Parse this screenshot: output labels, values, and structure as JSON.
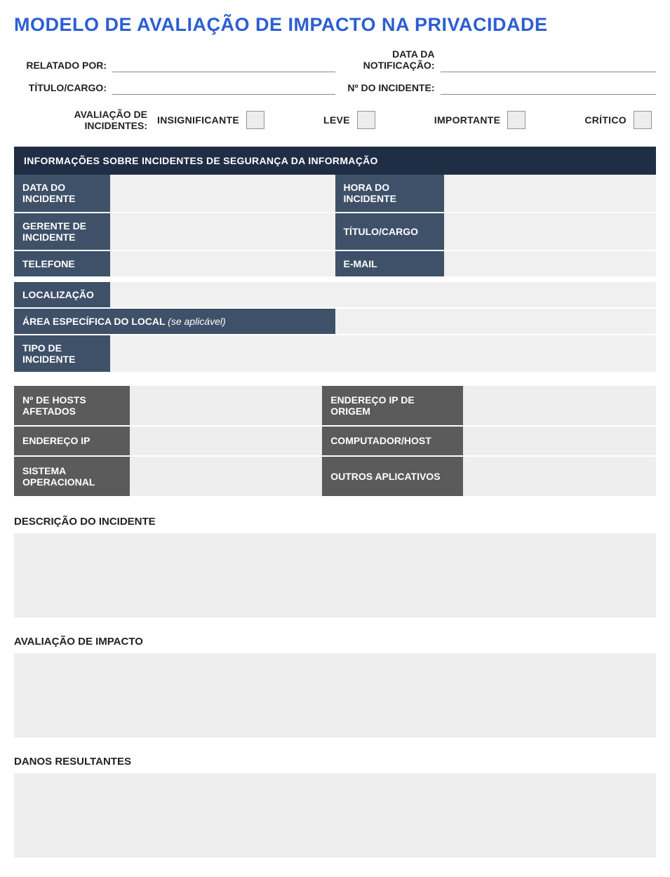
{
  "title": "MODELO DE AVALIAÇÃO DE IMPACTO NA PRIVACIDADE",
  "header": {
    "reported_by_label": "RELATADO POR:",
    "title_role_label": "TÍTULO/CARGO:",
    "notification_date_label": "DATA DA NOTIFICAÇÃO:",
    "incident_no_label": "Nº DO INCIDENTE:",
    "reported_by": "",
    "title_role": "",
    "notification_date": "",
    "incident_no": ""
  },
  "assessment": {
    "lead_label": "AVALIAÇÃO DE INCIDENTES:",
    "options": {
      "insignificant": "INSIGNIFICANTE",
      "light": "LEVE",
      "important": "IMPORTANTE",
      "critical": "CRÍTICO"
    }
  },
  "section_banner": "INFORMAÇÕES SOBRE INCIDENTES DE SEGURANÇA DA INFORMAÇÃO",
  "info": {
    "incident_date_label": "DATA DO INCIDENTE",
    "incident_time_label": "HORA DO INCIDENTE",
    "incident_manager_label": "GERENTE DE INCIDENTE",
    "title_role_label": "TÍTULO/CARGO",
    "phone_label": "TELEFONE",
    "email_label": "E-MAIL",
    "location_label": "LOCALIZAÇÃO",
    "specific_area_label": "ÁREA ESPECÍFICA DO LOCAL",
    "specific_area_hint": "(se aplicável)",
    "incident_type_label": "TIPO DE INCIDENTE",
    "incident_date": "",
    "incident_time": "",
    "incident_manager": "",
    "title_role": "",
    "phone": "",
    "email": "",
    "location": "",
    "specific_area": "",
    "incident_type": ""
  },
  "tech": {
    "hosts_affected_label": "Nº DE HOSTS AFETADOS",
    "source_ip_label": "ENDEREÇO IP DE ORIGEM",
    "ip_label": "ENDEREÇO IP",
    "computer_host_label": "COMPUTADOR/HOST",
    "os_label": "SISTEMA OPERACIONAL",
    "other_apps_label": "OUTROS APLICATIVOS",
    "hosts_affected": "",
    "source_ip": "",
    "ip": "",
    "computer_host": "",
    "os": "",
    "other_apps": ""
  },
  "sections": {
    "incident_description_label": "DESCRIÇÃO DO INCIDENTE",
    "impact_assessment_label": "AVALIAÇÃO DE IMPACTO",
    "resulting_damages_label": "DANOS RESULTANTES",
    "incident_description": "",
    "impact_assessment": "",
    "resulting_damages": ""
  }
}
